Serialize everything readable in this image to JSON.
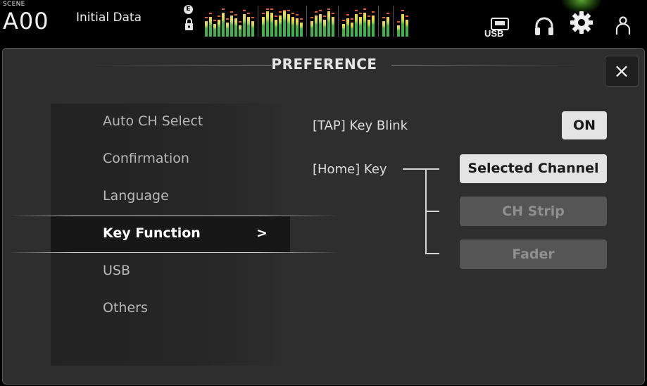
{
  "scene": {
    "label": "SCENE",
    "number": "A00",
    "name": "Initial Data"
  },
  "indicators": {
    "edit_badge": "E"
  },
  "meters": {
    "groups": [
      [
        0.55,
        0.7,
        0.45,
        0.6,
        0.85,
        0.5,
        0.75,
        0.65,
        0.4,
        0.8,
        0.7,
        0.55
      ],
      [
        0.7,
        0.9,
        0.85,
        0.6,
        0.75,
        0.95,
        0.8,
        0.7,
        0.65,
        0.5
      ],
      [
        0.55,
        0.75,
        0.8,
        0.6,
        0.9,
        0.7
      ],
      [
        0.45,
        0.65,
        0.5,
        0.8,
        0.7,
        0.85,
        0.6,
        0.75
      ],
      [
        0.55,
        0.7
      ],
      [
        0.4,
        0.8,
        0.6
      ]
    ],
    "accent_low": "#3fb24a",
    "accent_high": "#e8c94a"
  },
  "toolbar": {
    "usb_label": "USB",
    "icons": [
      "usb-icon",
      "headphones-icon",
      "gear-icon",
      "user-icon"
    ]
  },
  "panel": {
    "title": "PREFERENCE",
    "close_glyph": "×"
  },
  "menu": {
    "items": [
      {
        "label": "Auto CH Select",
        "active": false
      },
      {
        "label": "Confirmation",
        "active": false
      },
      {
        "label": "Language",
        "active": false
      },
      {
        "label": "Key Function",
        "active": true,
        "chevron": ">"
      },
      {
        "label": "USB",
        "active": false
      },
      {
        "label": "Others",
        "active": false
      }
    ]
  },
  "settings": {
    "tap_key_blink": {
      "label": "[TAP] Key Blink",
      "value": "ON"
    },
    "home_key": {
      "label": "[Home] Key",
      "options": [
        "Selected Channel",
        "CH Strip",
        "Fader"
      ],
      "selected": "Selected Channel"
    }
  }
}
